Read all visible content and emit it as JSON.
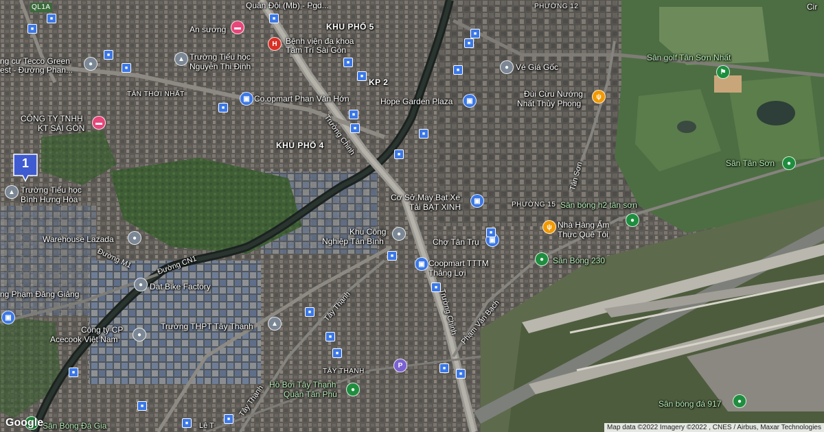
{
  "map": {
    "labels": {
      "khu_pho_5": "KHU PHỐ 5",
      "kp2": "KP 2",
      "khu_pho_4": "KHU PHỐ 4",
      "tan_thoi_nhat": "TÂN THỚI NHẤT",
      "phuong_12": "PHƯỜNG 12",
      "phuong_15": "PHƯỜNG 15",
      "tay_thanh": "TÂY THẠNH",
      "ql1a": "QL1A",
      "quan_doi": "Quân Đội (Mb) - Pgd...",
      "an_suong": "An sương",
      "benh_vien_1": "Bệnh viện đa khoa",
      "benh_vien_2": "Tâm Trí Sài Gòn",
      "tecco_1": "ng cư Tecco Green",
      "tecco_2": "est - Đường Phan...",
      "truong_nguyen_1": "Trường Tiểu học",
      "truong_nguyen_2": "Nguyễn Thị Định",
      "coopmart_pvh": "Co.opmart Phan Văn Hớn",
      "cong_ty_1": "CÔNG TY TNHH",
      "cong_ty_2": "KT SÀI GÒN",
      "truong_bhh_1": "Trường Tiểu học",
      "truong_bhh_2": "Bình Hưng Hòa",
      "warehouse": "Warehouse Lazada",
      "duong_m1": "Đường M1",
      "duong_cn1": "Đường CN1",
      "dat_bike": "Dat Bike Factory",
      "pham_dang_giang": "ng Phạm Đăng Giảng",
      "acecook_1": "Công ty CP",
      "acecook_2": "Acecook Việt Nam",
      "truong_thpt": "Trường THPT Tây Thạnh",
      "ve_gia_goc": "Vé Giá Gốc",
      "hope_garden": "Hope Garden Plaza",
      "dui_cuu_1": "Đùi Cừu Nướng",
      "dui_cuu_2": "Nhất Thủy Phong",
      "san_golf": "Sân golf Tân Sơn Nhất",
      "san_tan_son": "Sân Tân Sơn",
      "tan_son_road": "Tân Sơn",
      "truong_chinh_1": "Trường Chinh",
      "truong_chinh_2": "Trường Chinh",
      "co_so_1": "Cơ Sở May Bạt Xe",
      "co_so_2": "Tải BẠT XINH",
      "san_bong_h2": "Sân bóng h2 tân sơn",
      "nha_hang_1": "Nhà Hàng Ẩm",
      "nha_hang_2": "Thực Quê Tôi",
      "kcn_1": "Khu Công",
      "kcn_2": "Nghiệp Tân Bình",
      "cho_tan_tru": "Chợ Tân Trụ",
      "san_bong_230": "Sân Bóng 230",
      "coopmart_tttm_1": "Coopmart TTTM",
      "coopmart_tttm_2": "Thắng Lợi",
      "tay_thanh_road": "Tây Thạnh",
      "tay_thanh_road2": "Tây Thạnh",
      "pham_van_bach": "Phạm Văn Bạch",
      "ho_boi_1": "Hồ Bơi Tây Thạnh",
      "ho_boi_2": "Quận Tân Phú",
      "san_bong_917": "Sân bóng đá 917",
      "san_bong_da_gia": "Sân Bóng Đá Gia",
      "le_road": "Lê T",
      "cir": "Cir"
    },
    "marker_number": "1",
    "google_logo": "Google",
    "attribution": "Map data ©2022 Imagery ©2022 , CNES / Airbus, Maxar Technologies",
    "colors": {
      "pin_blue": "#3b78e7",
      "pin_pink": "#e8457a",
      "pin_red": "#d93025",
      "pin_gray": "#7b8794",
      "pin_orange": "#f29900",
      "pin_green": "#1e8e3e",
      "pin_purple": "#7b61d1",
      "marker_blue": "#3f5bd1"
    },
    "icons": {
      "lodging": "bed-icon",
      "hospital": "hospital-icon",
      "school": "school-icon",
      "shopping": "shopping-bag-icon",
      "restaurant": "restaurant-icon",
      "park": "park-icon",
      "place": "place-pin-icon",
      "bus": "bus-stop-icon",
      "parking": "parking-icon",
      "golf": "golf-icon"
    }
  }
}
